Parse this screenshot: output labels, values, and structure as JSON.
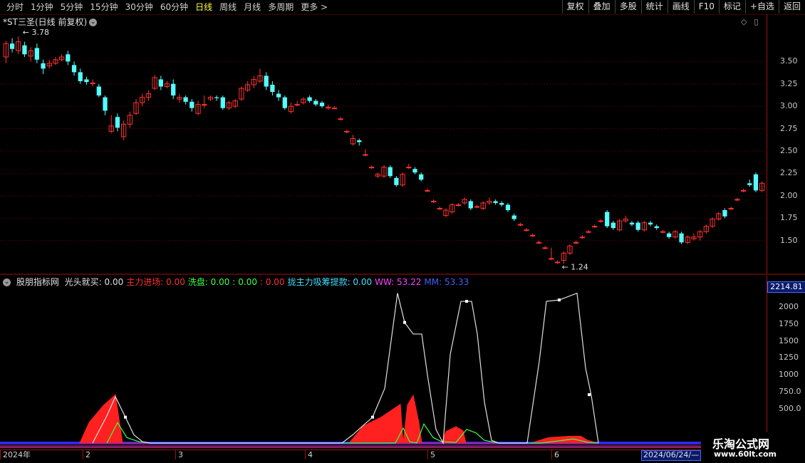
{
  "toolbar": {
    "periods": [
      "分时",
      "1分钟",
      "5分钟",
      "15分钟",
      "30分钟",
      "60分钟",
      "日线",
      "周线",
      "月线",
      "多周期",
      "更多 >"
    ],
    "active_period": "日线",
    "buttons": [
      "复权",
      "叠加",
      "多股",
      "统计",
      "画线",
      "F10",
      "标记",
      "+自选",
      "返回"
    ]
  },
  "stock": {
    "title": "*ST三圣(日线 前复权)"
  },
  "price_axis": {
    "ticks": [
      "3.50",
      "3.25",
      "3.00",
      "2.75",
      "2.50",
      "2.25",
      "2.00",
      "1.75",
      "1.50"
    ],
    "range": [
      1.18,
      3.9
    ]
  },
  "price_labels": {
    "high": "3.78",
    "low": "1.24"
  },
  "indicator": {
    "name": "股朋指标网",
    "items": [
      {
        "label": "光头就买:",
        "value": "0.00",
        "color": "#e0e0e0"
      },
      {
        "label": "主力进场:",
        "value": "0.00",
        "color": "#ff3030"
      },
      {
        "label": "洗盘:",
        "value": "0.00",
        "color": "#40ff40"
      },
      {
        "label": ":",
        "value": "0.00",
        "color": "#40ff40"
      },
      {
        "label": ":",
        "value": "0.00",
        "color": "#ff3030"
      },
      {
        "label": "拢主力吸筹提款:",
        "value": "0.00",
        "color": "#40e0ff"
      },
      {
        "label": "WW:",
        "value": "53.22",
        "color": "#ff40ff"
      },
      {
        "label": "MM:",
        "value": "53.33",
        "color": "#4060ff"
      }
    ],
    "axis_max_label": "2214.81",
    "axis_ticks": [
      "2000",
      "1750",
      "1500",
      "1250",
      "1000",
      "750.0",
      "500.0"
    ],
    "range": [
      0,
      2300
    ]
  },
  "dates": {
    "labels": [
      "2024年",
      "2",
      "3",
      "4",
      "5",
      "6"
    ],
    "current": "2024/06/24/—"
  },
  "watermark": {
    "title": "乐淘公式网",
    "url": "www.60lt.com"
  },
  "colors": {
    "up": "#ff3232",
    "down": "#54ffff",
    "grid": "#7a0000",
    "axis": "#a01010"
  },
  "chart_data": [
    {
      "type": "candlestick",
      "title": "*ST三圣(日线 前复权)",
      "ylim": [
        1.18,
        3.9
      ],
      "candles": [
        [
          3.55,
          3.7,
          3.73,
          3.48
        ],
        [
          3.7,
          3.64,
          3.76,
          3.6
        ],
        [
          3.62,
          3.72,
          3.78,
          3.58
        ],
        [
          3.68,
          3.58,
          3.72,
          3.55
        ],
        [
          3.56,
          3.62,
          3.66,
          3.5
        ],
        [
          3.65,
          3.52,
          3.7,
          3.48
        ],
        [
          3.48,
          3.42,
          3.52,
          3.36
        ],
        [
          3.45,
          3.48,
          3.52,
          3.42
        ],
        [
          3.48,
          3.52,
          3.55,
          3.46
        ],
        [
          3.52,
          3.55,
          3.58,
          3.5
        ],
        [
          3.58,
          3.5,
          3.62,
          3.46
        ],
        [
          3.46,
          3.38,
          3.5,
          3.34
        ],
        [
          3.38,
          3.28,
          3.42,
          3.25
        ],
        [
          3.3,
          3.27,
          3.33,
          3.24
        ],
        [
          3.26,
          3.26,
          3.3,
          3.22
        ],
        [
          3.22,
          3.12,
          3.25,
          3.1
        ],
        [
          3.1,
          2.95,
          3.12,
          2.9
        ],
        [
          2.72,
          2.78,
          2.9,
          2.7
        ],
        [
          2.88,
          2.76,
          2.92,
          2.72
        ],
        [
          2.66,
          2.8,
          2.84,
          2.62
        ],
        [
          2.8,
          2.9,
          2.94,
          2.76
        ],
        [
          2.92,
          3.04,
          3.08,
          2.9
        ],
        [
          3.04,
          3.1,
          3.14,
          3.0
        ],
        [
          3.1,
          3.14,
          3.18,
          3.06
        ],
        [
          3.2,
          3.32,
          3.35,
          3.18
        ],
        [
          3.3,
          3.22,
          3.34,
          3.18
        ],
        [
          3.22,
          3.25,
          3.28,
          3.2
        ],
        [
          3.25,
          3.12,
          3.3,
          3.08
        ],
        [
          3.08,
          3.1,
          3.14,
          3.04
        ],
        [
          3.1,
          3.05,
          3.12,
          3.02
        ],
        [
          3.05,
          2.98,
          3.08,
          2.94
        ],
        [
          2.92,
          3.02,
          3.06,
          2.9
        ],
        [
          3.02,
          3.02,
          3.12,
          2.98
        ],
        [
          3.08,
          3.1,
          3.12,
          3.06
        ],
        [
          3.1,
          3.09,
          3.12,
          3.06
        ],
        [
          3.1,
          2.98,
          3.12,
          2.96
        ],
        [
          2.98,
          3.04,
          3.06,
          2.96
        ],
        [
          3.0,
          3.06,
          3.08,
          2.98
        ],
        [
          3.08,
          3.2,
          3.22,
          3.06
        ],
        [
          3.18,
          3.24,
          3.28,
          3.16
        ],
        [
          3.24,
          3.3,
          3.34,
          3.2
        ],
        [
          3.28,
          3.34,
          3.42,
          3.26
        ],
        [
          3.34,
          3.22,
          3.38,
          3.18
        ],
        [
          3.24,
          3.16,
          3.28,
          3.12
        ],
        [
          3.14,
          3.1,
          3.18,
          3.06
        ],
        [
          3.1,
          2.98,
          3.12,
          2.96
        ],
        [
          2.94,
          3.0,
          3.04,
          2.92
        ],
        [
          3.02,
          3.02,
          3.06,
          3.0
        ],
        [
          3.04,
          3.08,
          3.1,
          3.02
        ],
        [
          3.1,
          3.06,
          3.12,
          3.04
        ],
        [
          3.06,
          3.02,
          3.08,
          3.0
        ],
        [
          3.04,
          3.0,
          3.06,
          2.98
        ],
        [
          2.98,
          2.99,
          3.02,
          2.96
        ],
        [
          2.98,
          2.98,
          3.0,
          2.97
        ],
        [
          2.86,
          2.86,
          2.88,
          2.84
        ],
        [
          2.72,
          2.72,
          2.74,
          2.7
        ],
        [
          2.58,
          2.64,
          2.68,
          2.56
        ],
        [
          2.62,
          2.6,
          2.64,
          2.56
        ],
        [
          2.46,
          2.46,
          2.52,
          2.44
        ],
        [
          2.32,
          2.32,
          2.34,
          2.3
        ],
        [
          2.22,
          2.24,
          2.26,
          2.2
        ],
        [
          2.22,
          2.32,
          2.34,
          2.2
        ],
        [
          2.32,
          2.22,
          2.34,
          2.2
        ],
        [
          2.2,
          2.12,
          2.22,
          2.1
        ],
        [
          2.12,
          2.24,
          2.26,
          2.1
        ],
        [
          2.32,
          2.32,
          2.36,
          2.3
        ],
        [
          2.3,
          2.26,
          2.32,
          2.24
        ],
        [
          2.24,
          2.18,
          2.26,
          2.16
        ],
        [
          2.06,
          2.06,
          2.08,
          2.04
        ],
        [
          1.94,
          1.94,
          1.96,
          1.92
        ],
        [
          1.86,
          1.86,
          1.88,
          1.84
        ],
        [
          1.78,
          1.84,
          1.86,
          1.76
        ],
        [
          1.82,
          1.9,
          1.92,
          1.8
        ],
        [
          1.9,
          1.9,
          1.92,
          1.88
        ],
        [
          1.92,
          1.96,
          1.98,
          1.9
        ],
        [
          1.94,
          1.86,
          1.96,
          1.84
        ],
        [
          1.88,
          1.88,
          1.9,
          1.86
        ],
        [
          1.86,
          1.92,
          1.94,
          1.84
        ],
        [
          1.92,
          1.94,
          1.98,
          1.9
        ],
        [
          1.94,
          1.92,
          1.96,
          1.9
        ],
        [
          1.92,
          1.9,
          1.94,
          1.88
        ],
        [
          1.9,
          1.84,
          1.92,
          1.82
        ],
        [
          1.78,
          1.74,
          1.8,
          1.72
        ],
        [
          1.68,
          1.68,
          1.7,
          1.66
        ],
        [
          1.62,
          1.62,
          1.64,
          1.6
        ],
        [
          1.56,
          1.56,
          1.58,
          1.54
        ],
        [
          1.48,
          1.48,
          1.5,
          1.46
        ],
        [
          1.42,
          1.42,
          1.44,
          1.4
        ],
        [
          1.3,
          1.3,
          1.42,
          1.28
        ],
        [
          1.26,
          1.26,
          1.28,
          1.24
        ],
        [
          1.28,
          1.36,
          1.38,
          1.24
        ],
        [
          1.36,
          1.44,
          1.46,
          1.34
        ],
        [
          1.48,
          1.48,
          1.5,
          1.46
        ],
        [
          1.54,
          1.54,
          1.56,
          1.52
        ],
        [
          1.6,
          1.6,
          1.62,
          1.58
        ],
        [
          1.66,
          1.66,
          1.68,
          1.64
        ],
        [
          1.72,
          1.72,
          1.74,
          1.7
        ],
        [
          1.82,
          1.66,
          1.84,
          1.64
        ],
        [
          1.7,
          1.64,
          1.72,
          1.62
        ],
        [
          1.62,
          1.72,
          1.74,
          1.6
        ],
        [
          1.72,
          1.74,
          1.78,
          1.7
        ],
        [
          1.7,
          1.68,
          1.72,
          1.66
        ],
        [
          1.7,
          1.62,
          1.72,
          1.6
        ],
        [
          1.62,
          1.7,
          1.72,
          1.6
        ],
        [
          1.7,
          1.68,
          1.72,
          1.66
        ],
        [
          1.66,
          1.64,
          1.68,
          1.62
        ],
        [
          1.6,
          1.6,
          1.62,
          1.58
        ],
        [
          1.58,
          1.54,
          1.6,
          1.52
        ],
        [
          1.54,
          1.6,
          1.62,
          1.52
        ],
        [
          1.58,
          1.48,
          1.6,
          1.46
        ],
        [
          1.48,
          1.54,
          1.56,
          1.46
        ],
        [
          1.52,
          1.54,
          1.58,
          1.5
        ],
        [
          1.54,
          1.6,
          1.62,
          1.5
        ],
        [
          1.6,
          1.66,
          1.68,
          1.58
        ],
        [
          1.66,
          1.74,
          1.76,
          1.64
        ],
        [
          1.74,
          1.8,
          1.82,
          1.72
        ],
        [
          1.84,
          1.77,
          1.86,
          1.75
        ],
        [
          1.86,
          1.86,
          1.88,
          1.84
        ],
        [
          1.96,
          1.96,
          1.98,
          1.94
        ],
        [
          2.06,
          2.06,
          2.08,
          2.04
        ],
        [
          2.14,
          2.12,
          2.18,
          2.1
        ],
        [
          2.24,
          2.06,
          2.26,
          2.04
        ],
        [
          2.06,
          2.14,
          2.16,
          2.04
        ]
      ]
    },
    {
      "type": "line",
      "title": "股朋指标网",
      "ylim": [
        0,
        2300
      ],
      "series": [
        {
          "name": "光头就买",
          "color": "#e0e0e0",
          "points": [
            [
              130,
              0
            ],
            [
              150,
              400
            ],
            [
              162,
              680
            ],
            [
              176,
              380
            ],
            [
              188,
              120
            ],
            [
              200,
              20
            ],
            [
              210,
              0
            ],
            [
              480,
              0
            ],
            [
              495,
              120
            ],
            [
              523,
              380
            ],
            [
              540,
              800
            ],
            [
              558,
              2200
            ],
            [
              568,
              1770
            ],
            [
              580,
              1600
            ],
            [
              592,
              1600
            ],
            [
              600,
              1000
            ],
            [
              612,
              200
            ],
            [
              622,
              0
            ],
            [
              632,
              1300
            ],
            [
              647,
              2080
            ],
            [
              662,
              2080
            ],
            [
              670,
              1600
            ],
            [
              680,
              600
            ],
            [
              690,
              40
            ],
            [
              700,
              0
            ],
            [
              740,
              0
            ],
            [
              757,
              1200
            ],
            [
              767,
              2080
            ],
            [
              785,
              2100
            ],
            [
              810,
              2200
            ],
            [
              822,
              1100
            ],
            [
              830,
              700
            ],
            [
              840,
              0
            ]
          ]
        },
        {
          "name": "主力进场",
          "color": "#ff2020",
          "area": true,
          "points": [
            [
              112,
              0
            ],
            [
              125,
              300
            ],
            [
              145,
              550
            ],
            [
              162,
              710
            ],
            [
              172,
              0
            ],
            [
              490,
              0
            ],
            [
              510,
              250
            ],
            [
              535,
              380
            ],
            [
              555,
              520
            ],
            [
              562,
              570
            ],
            [
              566,
              0
            ],
            [
              572,
              560
            ],
            [
              580,
              700
            ],
            [
              588,
              300
            ],
            [
              592,
              0
            ],
            [
              620,
              0
            ],
            [
              626,
              170
            ],
            [
              640,
              240
            ],
            [
              650,
              180
            ],
            [
              654,
              0
            ],
            [
              745,
              0
            ],
            [
              770,
              80
            ],
            [
              800,
              100
            ],
            [
              815,
              100
            ],
            [
              825,
              40
            ],
            [
              840,
              0
            ]
          ]
        },
        {
          "name": "洗盘",
          "color": "#40ff40",
          "points": [
            [
              150,
              0
            ],
            [
              165,
              300
            ],
            [
              178,
              80
            ],
            [
              195,
              20
            ],
            [
              212,
              0
            ],
            [
              555,
              0
            ],
            [
              566,
              220
            ],
            [
              575,
              20
            ],
            [
              585,
              0
            ],
            [
              595,
              280
            ],
            [
              608,
              80
            ],
            [
              620,
              20
            ],
            [
              640,
              10
            ],
            [
              655,
              200
            ],
            [
              668,
              150
            ],
            [
              680,
              40
            ],
            [
              700,
              0
            ],
            [
              760,
              0
            ],
            [
              805,
              60
            ],
            [
              825,
              10
            ],
            [
              840,
              0
            ]
          ]
        }
      ]
    }
  ]
}
